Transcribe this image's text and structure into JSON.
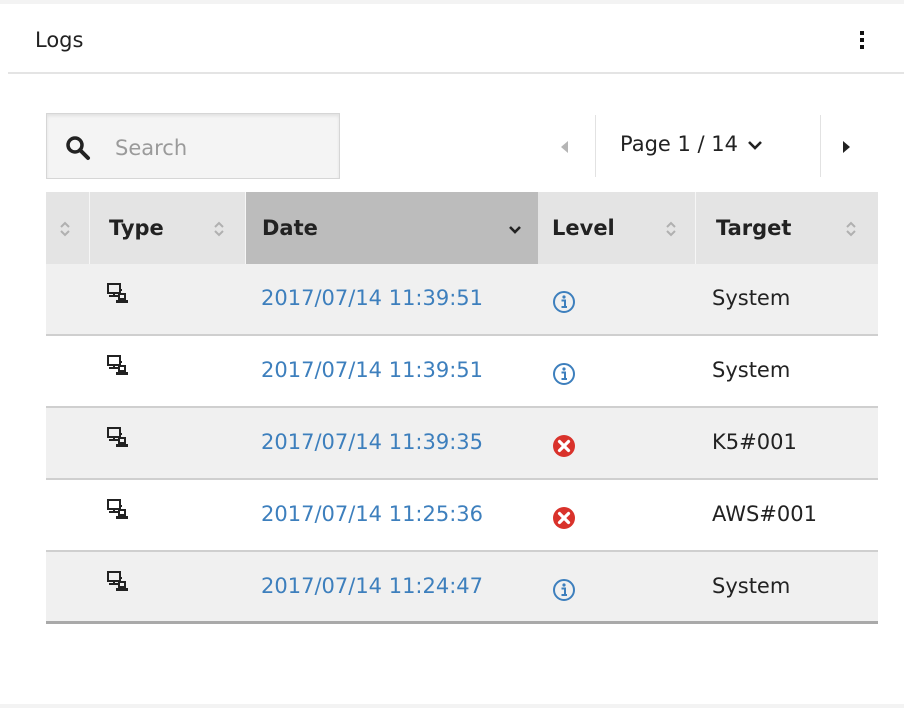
{
  "panel": {
    "title": "Logs",
    "menu_icon": "vertical-ellipsis-icon"
  },
  "search": {
    "icon": "search-icon",
    "placeholder": "Search",
    "value": ""
  },
  "pagination": {
    "prev_icon": "triangle-left-icon",
    "page_label": "Page 1 / 14",
    "dropdown_icon": "chevron-down-icon",
    "next_icon": "triangle-right-icon"
  },
  "table": {
    "columns": [
      {
        "label": "",
        "sort_icon": "sort-updown-icon"
      },
      {
        "label": "Type",
        "sort_icon": "sort-updown-icon"
      },
      {
        "label": "Date",
        "sort_icon": "chevron-down-icon",
        "sorted": "desc"
      },
      {
        "label": "Level",
        "sort_icon": "sort-updown-icon"
      },
      {
        "label": "Target",
        "sort_icon": "sort-updown-icon"
      }
    ],
    "rows": [
      {
        "type_icon": "computer-network-icon",
        "date": "2017/07/14 11:39:51",
        "level": "info",
        "target": "System"
      },
      {
        "type_icon": "computer-network-icon",
        "date": "2017/07/14 11:39:51",
        "level": "info",
        "target": "System"
      },
      {
        "type_icon": "computer-network-icon",
        "date": "2017/07/14 11:39:35",
        "level": "error",
        "target": "K5#001"
      },
      {
        "type_icon": "computer-network-icon",
        "date": "2017/07/14 11:25:36",
        "level": "error",
        "target": "AWS#001"
      },
      {
        "type_icon": "computer-network-icon",
        "date": "2017/07/14 11:24:47",
        "level": "info",
        "target": "System"
      }
    ]
  },
  "colors": {
    "link": "#3d7fbd",
    "header_bg": "#e4e4e4",
    "sorted_header_bg": "#bcbcbc",
    "error": "#d9322b",
    "info": "#3d7fbd"
  }
}
